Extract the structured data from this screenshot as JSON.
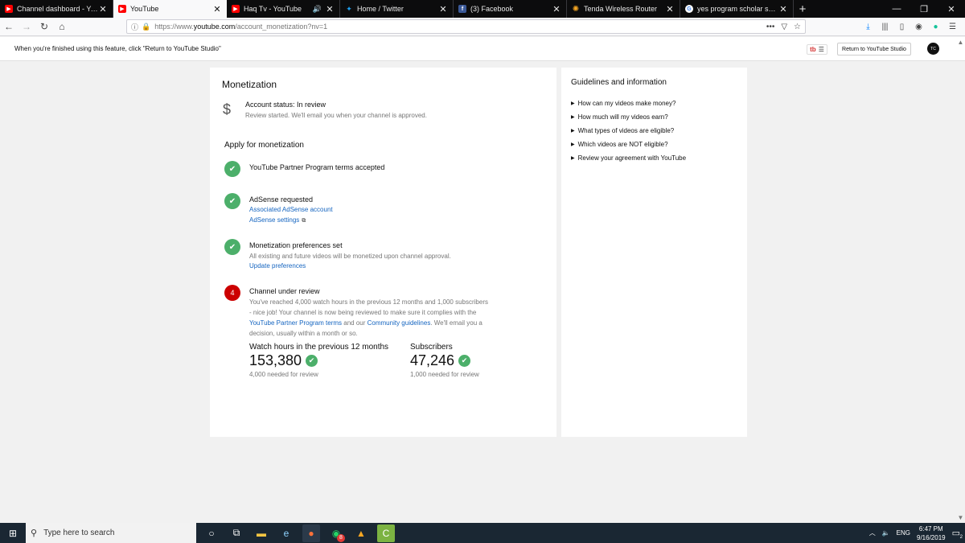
{
  "browser": {
    "tabs": [
      {
        "title": "Channel dashboard - YouTube",
        "icon": "youtube-icon",
        "active": false
      },
      {
        "title": "YouTube",
        "icon": "youtube-icon",
        "active": true
      },
      {
        "title": "Haq Tv - YouTube",
        "icon": "youtube-icon",
        "active": false
      },
      {
        "title": "Home / Twitter",
        "icon": "twitter-icon",
        "active": false
      },
      {
        "title": "(3) Facebook",
        "icon": "facebook-icon",
        "active": false
      },
      {
        "title": "Tenda Wireless Router",
        "icon": "tenda-icon",
        "active": false
      },
      {
        "title": "yes program scholar ship - Goo",
        "icon": "google-icon",
        "active": false
      }
    ],
    "url_prefix": "https://www.",
    "url_host": "youtube.com",
    "url_rest": "/account_monetization?nv=1",
    "url_more": "•••"
  },
  "studio_bar": {
    "message": "When you're finished using this feature, click \"Return to YouTube Studio\"",
    "tb_icon_label": "tb",
    "return_label": "Return to YouTube Studio",
    "avatar_label": "TC"
  },
  "monetization": {
    "title": "Monetization",
    "account_status": "Account status: In review",
    "account_sub": "Review started. We'll email you when your channel is approved.",
    "apply_heading": "Apply for monetization",
    "steps": [
      {
        "title": "YouTube Partner Program terms accepted"
      },
      {
        "title": "AdSense requested",
        "link1": "Associated AdSense account",
        "link2": "AdSense settings"
      },
      {
        "title": "Monetization preferences set",
        "desc": "All existing and future videos will be monetized upon channel approval.",
        "link": "Update preferences"
      },
      {
        "number": "4",
        "title": "Channel under review",
        "para_part1": "You've reached 4,000 watch hours in the previous 12 months and 1,000 subscribers - nice job! Your channel is now being reviewed to make sure it complies with the",
        "link_terms": "YouTube Partner Program terms",
        "para_part2": "and our",
        "link_guidelines": "Community guidelines",
        "para_part3": ". We'll email you a decision, usually within a month or so."
      }
    ],
    "stats": [
      {
        "label": "Watch hours in the previous 12 months",
        "value": "153,380",
        "needed": "4,000 needed for review"
      },
      {
        "label": "Subscribers",
        "value": "47,246",
        "needed": "1,000 needed for review"
      }
    ]
  },
  "guidelines": {
    "title": "Guidelines and information",
    "items": [
      "How can my videos make money?",
      "How much will my videos earn?",
      "What types of videos are eligible?",
      "Which videos are NOT eligible?",
      "Review your agreement with YouTube"
    ]
  },
  "taskbar": {
    "search_placeholder": "Type here to search",
    "notification_badge": "8",
    "language": "ENG",
    "time": "6:47 PM",
    "date": "9/16/2019",
    "action_center_count": "2"
  },
  "colors": {
    "accent_link": "#1565c0",
    "success_green": "#4caf6a",
    "status_red": "#cc0000",
    "youtube_red": "#ff0000",
    "taskbar": "#1a2733"
  }
}
